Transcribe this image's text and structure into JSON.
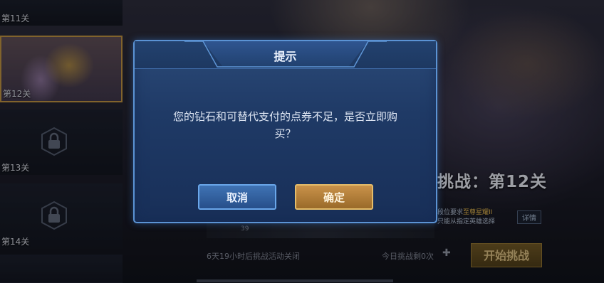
{
  "dialog": {
    "title": "提示",
    "message_line1": "您的钻石和可替代支付的点券不足，是否立即购",
    "message_line2": "买？",
    "cancel_label": "取消",
    "confirm_label": "确定"
  },
  "levels": [
    {
      "label": "第11关",
      "locked": false
    },
    {
      "label": "第12关",
      "locked": false,
      "selected": true
    },
    {
      "label": "第13关",
      "locked": true
    },
    {
      "label": "第14关",
      "locked": true
    }
  ],
  "background": {
    "stage_title": "挑战：第12关",
    "requirement_line1": "段位要求至尊星耀II",
    "requirement_highlight": "至尊星耀II",
    "requirement_line2": "只能从指定英雄选择",
    "detail_label": "详情",
    "timer_text": "6天19小时后挑战活动关闭",
    "today_text": "今日挑战剩0次",
    "start_label": "开始挑战",
    "strip_number": "39"
  },
  "colors": {
    "dialog_border": "#5b93d4",
    "confirm_gold": "#c9924a",
    "cancel_blue": "#3f73b4",
    "highlight_gold": "#e2b54c"
  }
}
